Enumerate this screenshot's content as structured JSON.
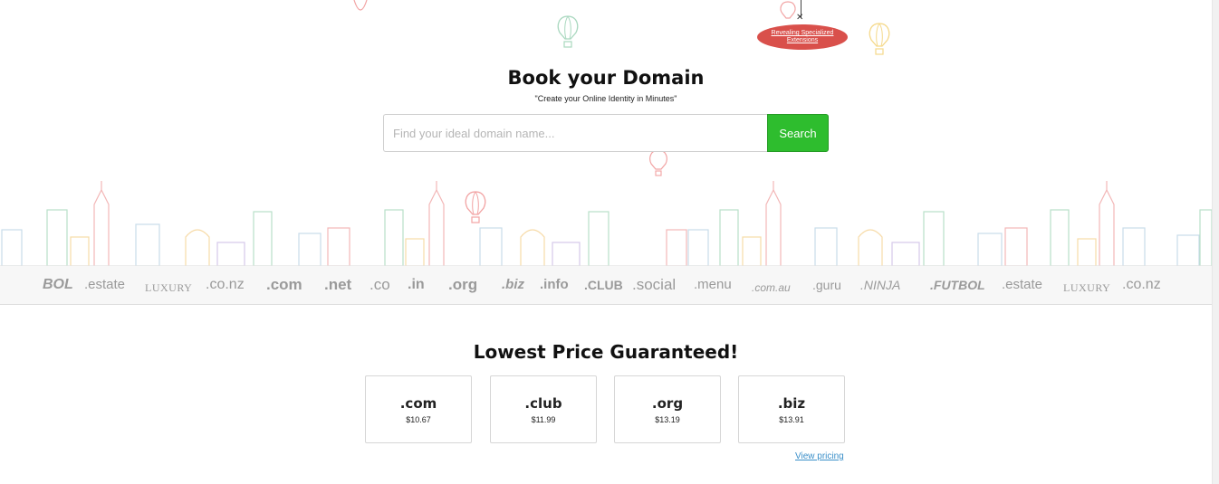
{
  "promo": {
    "label": "Revealing Specialized Extensions"
  },
  "hero": {
    "title": "Book your Domain",
    "subtitle": "\"Create your Online Identity in Minutes\""
  },
  "search": {
    "placeholder": "Find your ideal domain name...",
    "button_label": "Search"
  },
  "tld_strip": [
    "BOL",
    ".estate",
    "LUXURY",
    ".co.nz",
    ".com",
    ".net",
    ".co",
    ".in",
    ".org",
    ".biz",
    ".info",
    ".CLUB",
    ".social",
    ".menu",
    ".com.au",
    ".guru",
    ".NINJA",
    ".FUTBOL",
    ".estate",
    "LUXURY",
    ".co.nz"
  ],
  "pricing": {
    "title": "Lowest Price Guaranteed!",
    "cards": [
      {
        "ext": ".com",
        "price": "$10.67"
      },
      {
        "ext": ".club",
        "price": "$11.99"
      },
      {
        "ext": ".org",
        "price": "$13.19"
      },
      {
        "ext": ".biz",
        "price": "$13.91"
      }
    ],
    "view_pricing": "View pricing"
  },
  "colors": {
    "search_button": "#2ebd2e",
    "promo_tag": "#d9504b",
    "link": "#3a8fc9"
  }
}
